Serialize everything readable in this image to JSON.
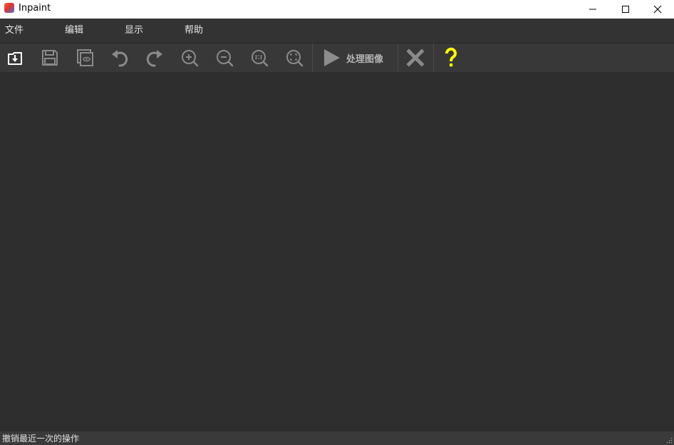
{
  "window": {
    "title": "Inpaint",
    "icon": "app-icon",
    "controls": [
      "minimize-icon",
      "maximize-icon",
      "close-icon"
    ]
  },
  "menu": {
    "file": "文件",
    "edit": "编辑",
    "view": "显示",
    "help": "帮助"
  },
  "toolbar": {
    "items": [
      "download-icon",
      "save-icon",
      "preview-icon",
      "undo-icon",
      "redo-icon",
      "zoom-in-icon",
      "zoom-out-icon",
      "zoom-actual-icon",
      "zoom-fit-icon"
    ],
    "process_label": "处理图像",
    "cancel_icon": "x-icon",
    "help_icon": "question-icon"
  },
  "colors": {
    "help_accent": "#ffff00",
    "background": "#2f2f2f"
  },
  "status": {
    "text": "撤销最近一次的操作"
  }
}
